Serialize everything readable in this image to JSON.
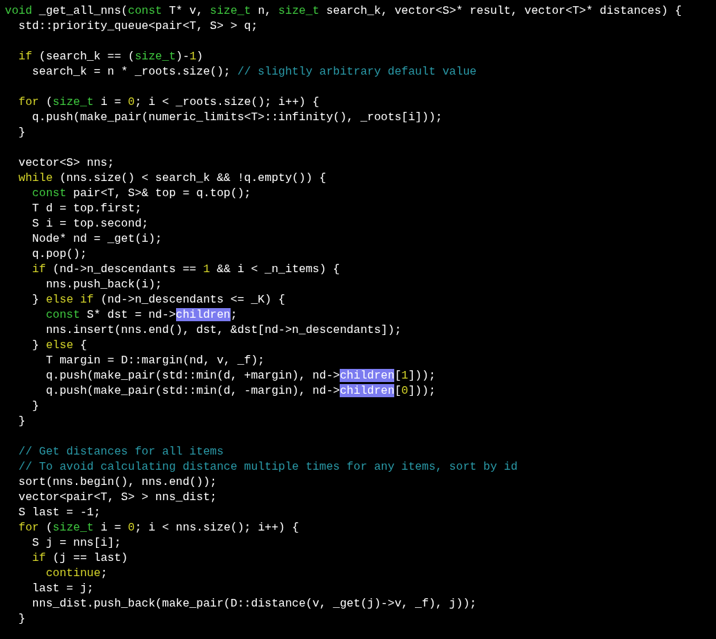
{
  "editor": {
    "lines": [
      {
        "kind": "code",
        "tokens": [
          {
            "kind": "type",
            "text": "void"
          },
          {
            "kind": "plain",
            "text": " _get_all_nns("
          },
          {
            "kind": "type",
            "text": "const"
          },
          {
            "kind": "plain",
            "text": " T* v, "
          },
          {
            "kind": "type",
            "text": "size_t"
          },
          {
            "kind": "plain",
            "text": " n, "
          },
          {
            "kind": "type",
            "text": "size_t"
          },
          {
            "kind": "plain",
            "text": " search_k, vector<S>* result, vector<T>* distances) {"
          }
        ]
      },
      {
        "kind": "code",
        "tokens": [
          {
            "kind": "plain",
            "text": "  std::priority_queue<pair<T, S> > q;"
          }
        ]
      },
      {
        "kind": "blank"
      },
      {
        "kind": "code",
        "tokens": [
          {
            "kind": "keyword",
            "text": "  if"
          },
          {
            "kind": "plain",
            "text": " (search_k == ("
          },
          {
            "kind": "type",
            "text": "size_t"
          },
          {
            "kind": "plain",
            "text": ")-"
          },
          {
            "kind": "number",
            "text": "1"
          },
          {
            "kind": "plain",
            "text": ")"
          }
        ]
      },
      {
        "kind": "code",
        "tokens": [
          {
            "kind": "plain",
            "text": "    search_k = n * _roots.size(); "
          },
          {
            "kind": "comment",
            "text": "// slightly arbitrary default value"
          }
        ]
      },
      {
        "kind": "blank"
      },
      {
        "kind": "code",
        "tokens": [
          {
            "kind": "keyword",
            "text": "  for"
          },
          {
            "kind": "plain",
            "text": " ("
          },
          {
            "kind": "type",
            "text": "size_t"
          },
          {
            "kind": "plain",
            "text": " i = "
          },
          {
            "kind": "number",
            "text": "0"
          },
          {
            "kind": "plain",
            "text": "; i < _roots.size(); i++) {"
          }
        ]
      },
      {
        "kind": "code",
        "tokens": [
          {
            "kind": "plain",
            "text": "    q.push(make_pair(numeric_limits<T>::infinity(), _roots[i]));"
          }
        ]
      },
      {
        "kind": "code",
        "tokens": [
          {
            "kind": "plain",
            "text": "  }"
          }
        ]
      },
      {
        "kind": "blank"
      },
      {
        "kind": "code",
        "tokens": [
          {
            "kind": "plain",
            "text": "  vector<S> nns;"
          }
        ]
      },
      {
        "kind": "code",
        "tokens": [
          {
            "kind": "keyword",
            "text": "  while"
          },
          {
            "kind": "plain",
            "text": " (nns.size() < search_k && !q.empty()) {"
          }
        ]
      },
      {
        "kind": "code",
        "tokens": [
          {
            "kind": "type",
            "text": "    const"
          },
          {
            "kind": "plain",
            "text": " pair<T, S>& top = q.top();"
          }
        ]
      },
      {
        "kind": "code",
        "tokens": [
          {
            "kind": "plain",
            "text": "    T d = top.first;"
          }
        ]
      },
      {
        "kind": "code",
        "tokens": [
          {
            "kind": "plain",
            "text": "    S i = top.second;"
          }
        ]
      },
      {
        "kind": "code",
        "tokens": [
          {
            "kind": "plain",
            "text": "    Node* nd = _get(i);"
          }
        ]
      },
      {
        "kind": "code",
        "tokens": [
          {
            "kind": "plain",
            "text": "    q.pop();"
          }
        ]
      },
      {
        "kind": "code",
        "tokens": [
          {
            "kind": "keyword",
            "text": "    if"
          },
          {
            "kind": "plain",
            "text": " (nd->n_descendants == "
          },
          {
            "kind": "number",
            "text": "1"
          },
          {
            "kind": "plain",
            "text": " && i < _n_items) {"
          }
        ]
      },
      {
        "kind": "code",
        "tokens": [
          {
            "kind": "plain",
            "text": "      nns.push_back(i);"
          }
        ]
      },
      {
        "kind": "code",
        "tokens": [
          {
            "kind": "plain",
            "text": "    } "
          },
          {
            "kind": "keyword",
            "text": "else if"
          },
          {
            "kind": "plain",
            "text": " (nd->n_descendants <= _K) {"
          }
        ]
      },
      {
        "kind": "code",
        "tokens": [
          {
            "kind": "type",
            "text": "      const"
          },
          {
            "kind": "plain",
            "text": " S* dst = nd->"
          },
          {
            "kind": "match",
            "text": "children"
          },
          {
            "kind": "plain",
            "text": ";"
          }
        ]
      },
      {
        "kind": "code",
        "tokens": [
          {
            "kind": "plain",
            "text": "      nns.insert(nns.end(), dst, &dst[nd->n_descendants]);"
          }
        ]
      },
      {
        "kind": "code",
        "tokens": [
          {
            "kind": "plain",
            "text": "    } "
          },
          {
            "kind": "keyword",
            "text": "else"
          },
          {
            "kind": "plain",
            "text": " {"
          }
        ]
      },
      {
        "kind": "code",
        "tokens": [
          {
            "kind": "plain",
            "text": "      T margin = D::margin(nd, v, _f);"
          }
        ]
      },
      {
        "kind": "code",
        "tokens": [
          {
            "kind": "plain",
            "text": "      q.push(make_pair(std::min(d, +margin), nd->"
          },
          {
            "kind": "match",
            "text": "children"
          },
          {
            "kind": "plain",
            "text": "["
          },
          {
            "kind": "number",
            "text": "1"
          },
          {
            "kind": "plain",
            "text": "]));"
          }
        ]
      },
      {
        "kind": "code",
        "tokens": [
          {
            "kind": "plain",
            "text": "      q.push(make_pair(std::min(d, -margin), nd->"
          },
          {
            "kind": "match",
            "text": "children"
          },
          {
            "kind": "plain",
            "text": "["
          },
          {
            "kind": "number",
            "text": "0"
          },
          {
            "kind": "plain",
            "text": "]));"
          }
        ]
      },
      {
        "kind": "code",
        "tokens": [
          {
            "kind": "plain",
            "text": "    }"
          }
        ]
      },
      {
        "kind": "code",
        "tokens": [
          {
            "kind": "plain",
            "text": "  }"
          }
        ]
      },
      {
        "kind": "blank"
      },
      {
        "kind": "code",
        "tokens": [
          {
            "kind": "comment",
            "text": "  // Get distances for all items"
          }
        ]
      },
      {
        "kind": "code",
        "tokens": [
          {
            "kind": "comment",
            "text": "  // To avoid calculating distance multiple times for any items, sort by id"
          }
        ]
      },
      {
        "kind": "code",
        "tokens": [
          {
            "kind": "plain",
            "text": "  sort(nns.begin(), nns.end());"
          }
        ]
      },
      {
        "kind": "code",
        "tokens": [
          {
            "kind": "plain",
            "text": "  vector<pair<T, S> > nns_dist;"
          }
        ]
      },
      {
        "kind": "code",
        "tokens": [
          {
            "kind": "plain",
            "text": "  S last = -1;"
          }
        ]
      },
      {
        "kind": "code",
        "tokens": [
          {
            "kind": "keyword",
            "text": "  for"
          },
          {
            "kind": "plain",
            "text": " ("
          },
          {
            "kind": "type",
            "text": "size_t"
          },
          {
            "kind": "plain",
            "text": " i = "
          },
          {
            "kind": "number",
            "text": "0"
          },
          {
            "kind": "plain",
            "text": "; i < nns.size(); i++) {"
          }
        ]
      },
      {
        "kind": "code",
        "tokens": [
          {
            "kind": "plain",
            "text": "    S j = nns[i];"
          }
        ]
      },
      {
        "kind": "code",
        "tokens": [
          {
            "kind": "keyword",
            "text": "    if"
          },
          {
            "kind": "plain",
            "text": " (j == last)"
          }
        ]
      },
      {
        "kind": "code",
        "tokens": [
          {
            "kind": "keyword",
            "text": "      continue"
          },
          {
            "kind": "plain",
            "text": ";"
          }
        ]
      },
      {
        "kind": "code",
        "tokens": [
          {
            "kind": "plain",
            "text": "    last = j;"
          }
        ]
      },
      {
        "kind": "code",
        "tokens": [
          {
            "kind": "plain",
            "text": "    nns_dist.push_back(make_pair(D::distance(v, _get(j)->v, _f), j));"
          }
        ]
      },
      {
        "kind": "code",
        "tokens": [
          {
            "kind": "plain",
            "text": "  }"
          }
        ]
      }
    ]
  }
}
